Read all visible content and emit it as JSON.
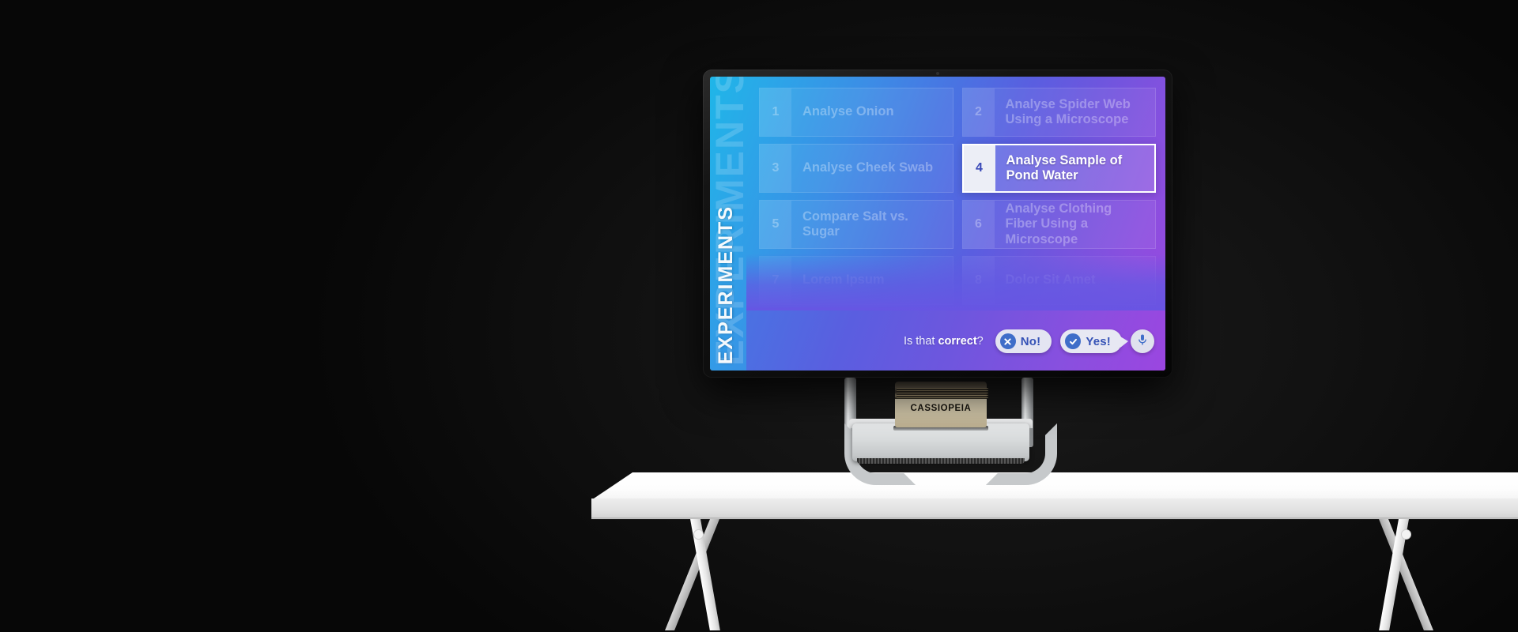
{
  "scene": {
    "background_color": "#0a0a0a",
    "desk": {
      "name": "white trestle desk",
      "color": "#ffffff"
    },
    "device": {
      "label": "CASSIOPEIA"
    }
  },
  "screen": {
    "side_title": "EXPERIMENTS",
    "gradient_from": "#1fb6e8",
    "gradient_to": "#9b46e0",
    "accent_color": "#3552b6",
    "items": [
      {
        "number": "1",
        "label": "Analyse Onion",
        "selected": false,
        "dim": "dim"
      },
      {
        "number": "2",
        "label": "Analyse  Spider Web Using a Microscope",
        "selected": false,
        "dim": "dim"
      },
      {
        "number": "3",
        "label": "Analyse Cheek Swab",
        "selected": false,
        "dim": "dim"
      },
      {
        "number": "4",
        "label": "Analyse Sample of Pond Water",
        "selected": true,
        "dim": ""
      },
      {
        "number": "5",
        "label": "Compare Salt vs. Sugar",
        "selected": false,
        "dim": "dim"
      },
      {
        "number": "6",
        "label": "Analyse Clothing Fiber Using a Microscope",
        "selected": false,
        "dim": "dim"
      },
      {
        "number": "7",
        "label": "Lorem Ipsum",
        "selected": false,
        "dim": "dimmer"
      },
      {
        "number": "8",
        "label": "Dolor Sit Amet",
        "selected": false,
        "dim": "dimmer"
      }
    ],
    "prompt": {
      "question_prefix": "Is that ",
      "question_bold": "correct",
      "question_suffix": "?",
      "no_label": "No!",
      "yes_label": "Yes!",
      "no_icon": "x-circle-icon",
      "yes_icon": "check-circle-icon",
      "mic_icon": "microphone-icon"
    }
  }
}
